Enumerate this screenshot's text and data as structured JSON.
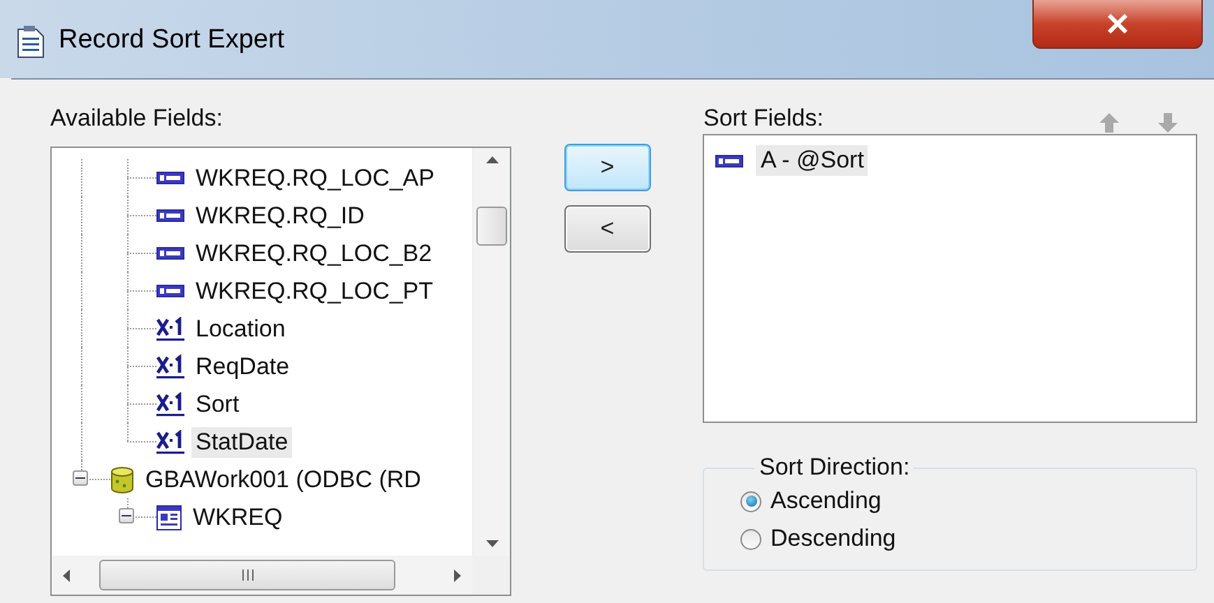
{
  "window": {
    "title": "Record Sort Expert"
  },
  "available_fields": {
    "label": "Available Fields:",
    "tree": [
      {
        "kind": "continuation",
        "children": [
          {
            "kind": "field",
            "label": "WKREQ.RQ_LOC_AP",
            "selected": false
          },
          {
            "kind": "field",
            "label": "WKREQ.RQ_ID",
            "selected": false
          },
          {
            "kind": "field",
            "label": "WKREQ.RQ_LOC_B2",
            "selected": false
          },
          {
            "kind": "field",
            "label": "WKREQ.RQ_LOC_PT",
            "selected": false
          },
          {
            "kind": "formula",
            "label": "Location",
            "selected": false
          },
          {
            "kind": "formula",
            "label": "ReqDate",
            "selected": false
          },
          {
            "kind": "formula",
            "label": "Sort",
            "selected": false
          },
          {
            "kind": "formula",
            "label": "StatDate",
            "selected": true
          }
        ]
      },
      {
        "kind": "database",
        "label": "GBAWork001 (ODBC (RD",
        "selected": false,
        "expanded": true,
        "children": [
          {
            "kind": "table",
            "label": "WKREQ",
            "selected": false,
            "expanded": true
          }
        ]
      }
    ]
  },
  "move_buttons": [
    {
      "label": ">",
      "focused": true
    },
    {
      "label": "<",
      "focused": false
    }
  ],
  "sort_fields": {
    "label": "Sort Fields:",
    "items": [
      {
        "kind": "field",
        "label": "A - @Sort",
        "selected": true
      }
    ]
  },
  "sort_direction": {
    "label": "Sort Direction:",
    "options": [
      {
        "label": "Ascending",
        "selected": true
      },
      {
        "label": "Descending",
        "selected": false
      }
    ]
  }
}
